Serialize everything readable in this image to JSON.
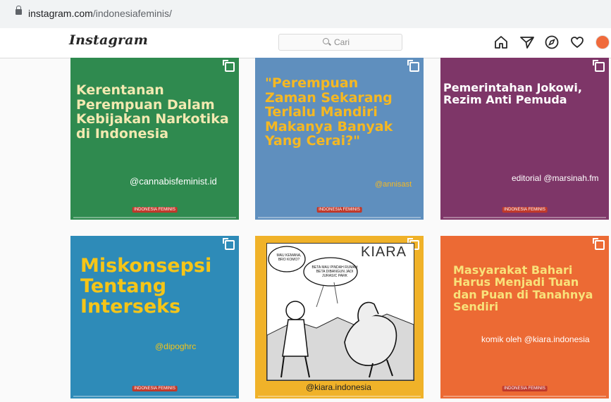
{
  "browser": {
    "url_host": "instagram.com",
    "url_path": "/indonesiafeminis/"
  },
  "nav": {
    "logo": "Instagram",
    "search_placeholder": "Cari"
  },
  "posts": [
    {
      "text": "Kerentanan Perempuan Dalam Kebijakan Narkotika di Indonesia",
      "handle": "@cannabisfeminist.id",
      "color": "#2f8a4f"
    },
    {
      "text": "\"Perempuan Zaman Sekarang Terlalu Mandiri Makanya Banyak Yang Cerai?\"",
      "handle": "@annisast",
      "color": "#5f8fbe"
    },
    {
      "text": "Pemerintahan Jokowi, Rezim Anti Pemuda",
      "handle": "editorial @marsinah.fm",
      "color": "#7e3668"
    },
    {
      "text": "Miskonsepsi Tentang Interseks",
      "handle": "@dipoghrc",
      "color": "#2e8bb8"
    },
    {
      "brand": "KIARA",
      "bubble1": "MAU KEMANA, BRO KOMO?",
      "bubble2": "BETA MAU PINDAH RUMAH BETA DIBANGUN JADI JURASIC PARK",
      "handle": "@kiara.indonesia",
      "color": "#f0b229"
    },
    {
      "text": "Masyarakat Bahari Harus Menjadi Tuan dan Puan di Tanahnya Sendiri",
      "handle": "komik oleh @kiara.indonesia",
      "color": "#ec6a34"
    }
  ],
  "icons": [
    "lock-icon",
    "search-icon",
    "home-icon",
    "direct-icon",
    "explore-icon",
    "heart-icon",
    "multiple-posts-icon"
  ]
}
